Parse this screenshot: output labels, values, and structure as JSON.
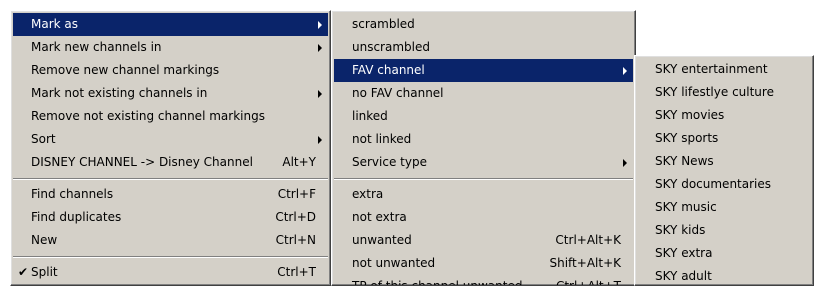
{
  "menu1": {
    "items": [
      {
        "label": "Mark as",
        "accel": "",
        "has_submenu": true
      },
      {
        "label": "Mark new channels in",
        "accel": "",
        "has_submenu": true
      },
      {
        "label": "Remove new channel markings",
        "accel": "",
        "has_submenu": false
      },
      {
        "label": "Mark not existing channels in",
        "accel": "",
        "has_submenu": true
      },
      {
        "label": "Remove not existing channel markings",
        "accel": "",
        "has_submenu": false
      },
      {
        "label": "Sort",
        "accel": "",
        "has_submenu": true
      },
      {
        "label": "DISNEY CHANNEL -> Disney Channel",
        "accel": "Alt+Y",
        "has_submenu": false
      },
      {
        "label": "Find channels",
        "accel": "Ctrl+F",
        "has_submenu": false
      },
      {
        "label": "Find duplicates",
        "accel": "Ctrl+D",
        "has_submenu": false
      },
      {
        "label": "New",
        "accel": "Ctrl+N",
        "has_submenu": false
      },
      {
        "label": "Split",
        "accel": "Ctrl+T",
        "has_submenu": false,
        "checked": true,
        "check_mark": "✔"
      }
    ]
  },
  "menu2": {
    "items": [
      {
        "label": "scrambled",
        "accel": ""
      },
      {
        "label": "unscrambled",
        "accel": ""
      },
      {
        "label": "FAV channel",
        "accel": "",
        "has_submenu": true
      },
      {
        "label": "no FAV channel",
        "accel": ""
      },
      {
        "label": "linked",
        "accel": ""
      },
      {
        "label": "not linked",
        "accel": ""
      },
      {
        "label": "Service type",
        "accel": "",
        "has_submenu": true
      },
      {
        "label": "extra",
        "accel": ""
      },
      {
        "label": "not extra",
        "accel": ""
      },
      {
        "label": "unwanted",
        "accel": "Ctrl+Alt+K"
      },
      {
        "label": "not unwanted",
        "accel": "Shift+Alt+K"
      },
      {
        "label": "TP of this channel unwanted",
        "accel": "Ctrl+Alt+T"
      }
    ]
  },
  "menu3": {
    "items": [
      {
        "label": "SKY entertainment"
      },
      {
        "label": "SKY lifestlye culture"
      },
      {
        "label": "SKY movies"
      },
      {
        "label": "SKY sports"
      },
      {
        "label": "SKY News"
      },
      {
        "label": "SKY documentaries"
      },
      {
        "label": "SKY music"
      },
      {
        "label": "SKY kids"
      },
      {
        "label": "SKY extra"
      },
      {
        "label": "SKY adult"
      }
    ]
  },
  "colors": {
    "menu_bg": "#d4d0c8",
    "highlight_bg": "#0a246a",
    "highlight_text": "#ffffff"
  }
}
